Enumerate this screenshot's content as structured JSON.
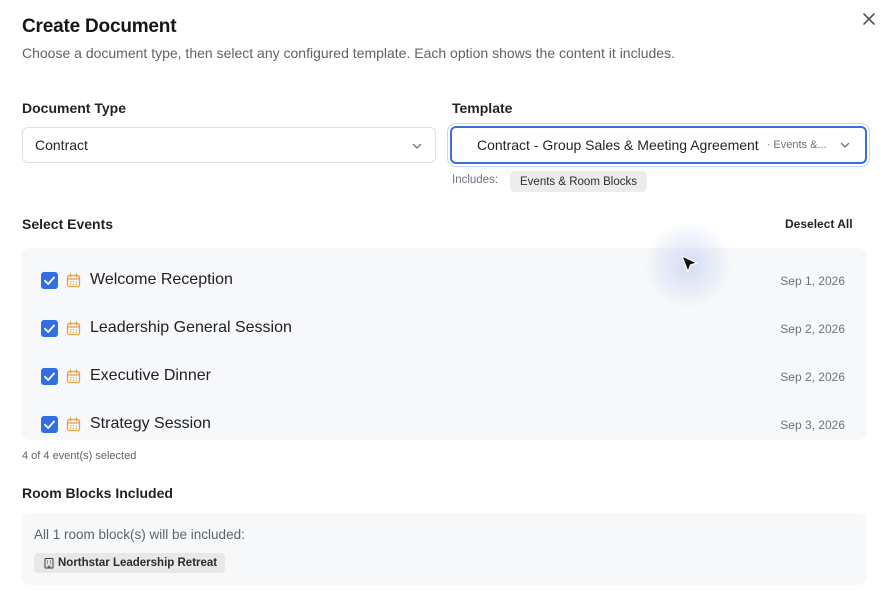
{
  "dialog": {
    "title": "Create Document",
    "subtitle": "Choose a document type, then select any configured template. Each option shows the content it includes.",
    "close_icon": "close-icon"
  },
  "document_type": {
    "label": "Document Type",
    "value": "Contract"
  },
  "template": {
    "label": "Template",
    "value": "Contract - Group Sales & Meeting Agreement",
    "value_suffix": "· Events &...",
    "includes_label": "Includes:",
    "includes": [
      "Events & Room Blocks"
    ]
  },
  "events": {
    "label": "Select Events",
    "deselect_label": "Deselect All",
    "items": [
      {
        "name": "Welcome Reception",
        "date": "Sep 1, 2026",
        "checked": true
      },
      {
        "name": "Leadership General Session",
        "date": "Sep 2, 2026",
        "checked": true
      },
      {
        "name": "Executive Dinner",
        "date": "Sep 2, 2026",
        "checked": true
      },
      {
        "name": "Strategy Session",
        "date": "Sep 3, 2026",
        "checked": true
      }
    ],
    "count_text": "4 of 4 event(s) selected"
  },
  "room_blocks": {
    "label": "Room Blocks Included",
    "summary": "All 1 room block(s) will be included:",
    "items": [
      "Northstar Leadership Retreat"
    ]
  },
  "colors": {
    "accent": "#2f6fe4",
    "calendar_icon": "#e6a23c",
    "panel_bg": "#f7f8f9"
  }
}
